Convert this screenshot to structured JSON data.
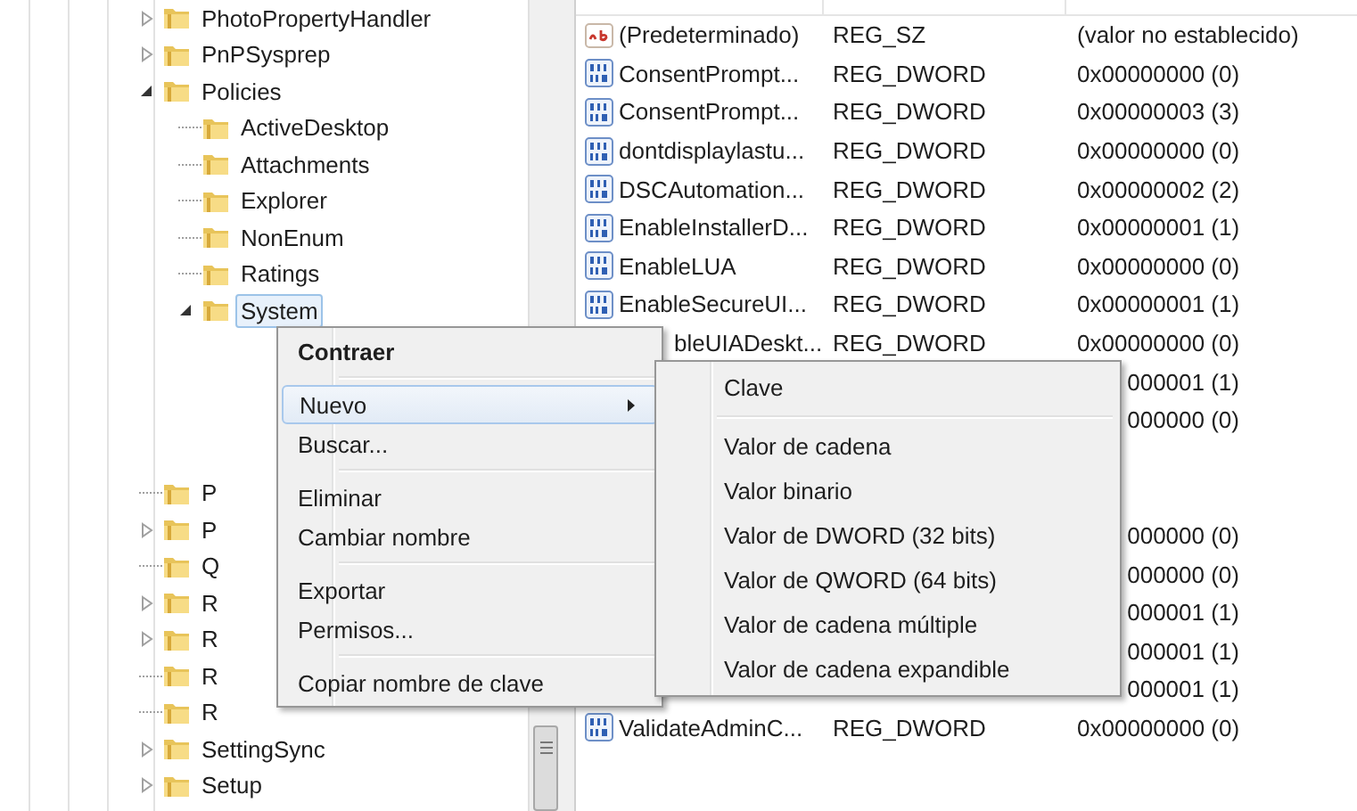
{
  "tree": {
    "items": [
      {
        "label": "PhotoPropertyHandler",
        "kind": "branch",
        "expanded": false,
        "selected": false
      },
      {
        "label": "PnPSysprep",
        "kind": "branch",
        "expanded": false,
        "selected": false
      },
      {
        "label": "Policies",
        "kind": "branch",
        "expanded": true,
        "selected": false,
        "children": [
          {
            "label": "ActiveDesktop",
            "kind": "leaf",
            "selected": false
          },
          {
            "label": "Attachments",
            "kind": "leaf",
            "selected": false
          },
          {
            "label": "Explorer",
            "kind": "leaf",
            "selected": false
          },
          {
            "label": "NonEnum",
            "kind": "leaf",
            "selected": false
          },
          {
            "label": "Ratings",
            "kind": "leaf",
            "selected": false
          },
          {
            "label": "System",
            "kind": "branch",
            "expanded": true,
            "selected": true
          }
        ]
      },
      {
        "label": "P",
        "kind": "leaf",
        "selected": false
      },
      {
        "label": "P",
        "kind": "branch",
        "expanded": false,
        "selected": false
      },
      {
        "label": "Q",
        "kind": "leaf",
        "selected": false
      },
      {
        "label": "R",
        "kind": "branch",
        "expanded": false,
        "selected": false
      },
      {
        "label": "R",
        "kind": "branch",
        "expanded": false,
        "selected": false
      },
      {
        "label": "R",
        "kind": "leaf",
        "selected": false
      },
      {
        "label": "R",
        "kind": "leaf",
        "selected": false
      },
      {
        "label": "SettingSync",
        "kind": "branch",
        "expanded": false,
        "selected": false
      },
      {
        "label": "Setup",
        "kind": "branch",
        "expanded": false,
        "selected": false
      }
    ]
  },
  "values": {
    "rows": [
      {
        "kind": "string",
        "name": "(Predeterminado)",
        "type": "REG_SZ",
        "data": "(valor no establecido)"
      },
      {
        "kind": "dword",
        "name": "ConsentPrompt...",
        "type": "REG_DWORD",
        "data": "0x00000000 (0)"
      },
      {
        "kind": "dword",
        "name": "ConsentPrompt...",
        "type": "REG_DWORD",
        "data": "0x00000003 (3)"
      },
      {
        "kind": "dword",
        "name": "dontdisplaylastu...",
        "type": "REG_DWORD",
        "data": "0x00000000 (0)"
      },
      {
        "kind": "dword",
        "name": "DSCAutomation...",
        "type": "REG_DWORD",
        "data": "0x00000002 (2)"
      },
      {
        "kind": "dword",
        "name": "EnableInstallerD...",
        "type": "REG_DWORD",
        "data": "0x00000001 (1)"
      },
      {
        "kind": "dword",
        "name": "EnableLUA",
        "type": "REG_DWORD",
        "data": "0x00000000 (0)"
      },
      {
        "kind": "dword",
        "name": "EnableSecureUI...",
        "type": "REG_DWORD",
        "data": "0x00000001 (1)"
      },
      {
        "kind": "partial",
        "name": "bleUIADeskt...",
        "type": "REG_DWORD",
        "data": "0x00000000 (0)"
      },
      {
        "kind": "covered",
        "data": "000001 (1)"
      },
      {
        "kind": "covered",
        "data": "000000 (0)"
      },
      {
        "kind": "hidden"
      },
      {
        "kind": "hidden"
      },
      {
        "kind": "covered",
        "data": "000000 (0)"
      },
      {
        "kind": "covered",
        "data": "000000 (0)"
      },
      {
        "kind": "covered",
        "data": "000001 (1)"
      },
      {
        "kind": "covered",
        "data": "000001 (1)"
      },
      {
        "kind": "covered",
        "data": "000001 (1)"
      },
      {
        "kind": "dword",
        "name": "ValidateAdminC...",
        "type": "REG_DWORD",
        "data": "0x00000000 (0)"
      }
    ]
  },
  "context_menu": {
    "groups": [
      [
        {
          "label": "Contraer",
          "default": true,
          "submenu": false,
          "selected": false
        }
      ],
      [
        {
          "label": "Nuevo",
          "default": false,
          "submenu": true,
          "selected": true
        },
        {
          "label": "Buscar...",
          "default": false,
          "submenu": false,
          "selected": false
        }
      ],
      [
        {
          "label": "Eliminar",
          "default": false,
          "submenu": false,
          "selected": false
        },
        {
          "label": "Cambiar nombre",
          "default": false,
          "submenu": false,
          "selected": false
        }
      ],
      [
        {
          "label": "Exportar",
          "default": false,
          "submenu": false,
          "selected": false
        },
        {
          "label": "Permisos...",
          "default": false,
          "submenu": false,
          "selected": false
        }
      ],
      [
        {
          "label": "Copiar nombre de clave",
          "default": false,
          "submenu": false,
          "selected": false
        }
      ]
    ]
  },
  "submenu": {
    "groups": [
      [
        "Clave"
      ],
      [
        "Valor de cadena",
        "Valor binario",
        "Valor de DWORD (32 bits)",
        "Valor de QWORD (64 bits)",
        "Valor de cadena múltiple",
        "Valor de cadena expandible"
      ]
    ]
  }
}
